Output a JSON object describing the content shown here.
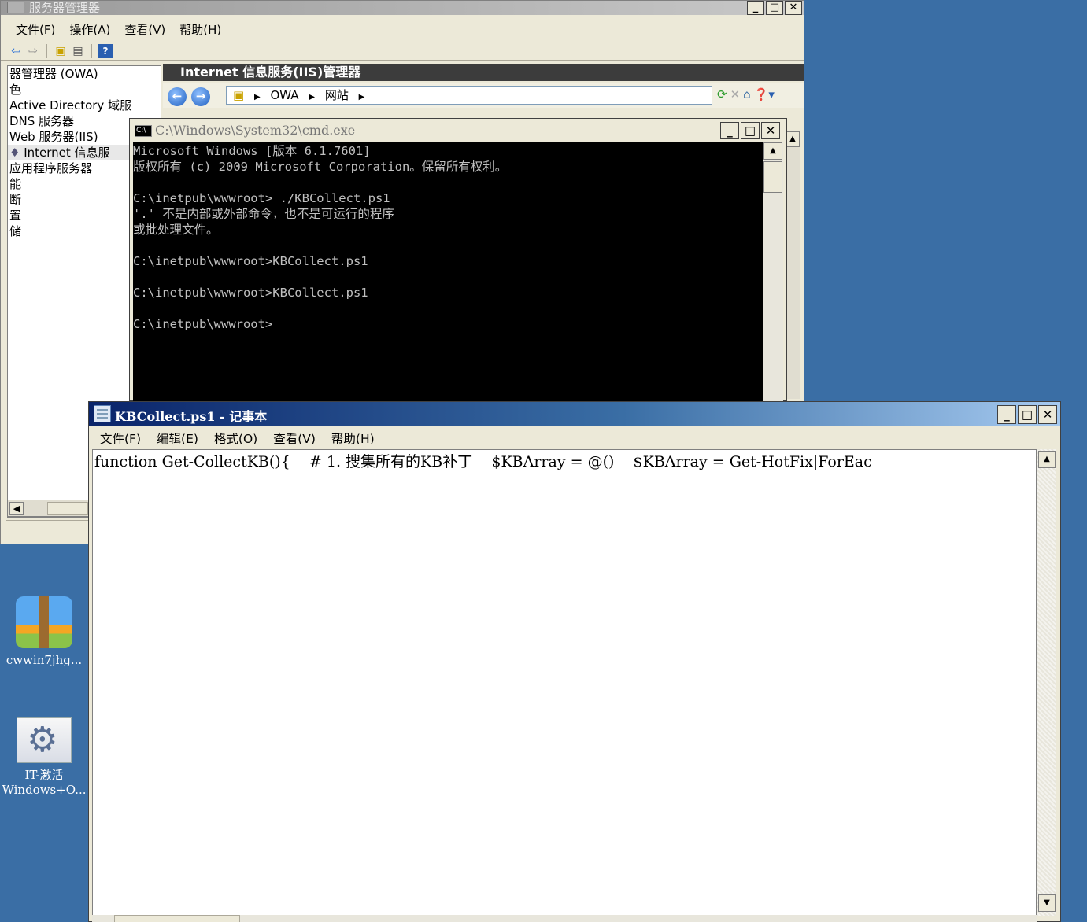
{
  "server_manager": {
    "title": "服务器管理器",
    "menu": [
      "文件(F)",
      "操作(A)",
      "查看(V)",
      "帮助(H)"
    ],
    "tree": [
      "器管理器 (OWA)",
      "色",
      "Active Directory 域服",
      "DNS 服务器",
      "Web 服务器(IIS)",
      "Internet 信息服",
      "应用程序服务器",
      "能",
      "断",
      "置",
      "储"
    ],
    "iis_header": "Internet 信息服务(IIS)管理器",
    "address": [
      "OWA",
      "网站"
    ]
  },
  "cmd": {
    "title": "C:\\Windows\\System32\\cmd.exe",
    "lines": [
      "Microsoft Windows [版本 6.1.7601]",
      "版权所有 (c) 2009 Microsoft Corporation。保留所有权利。",
      "",
      "C:\\inetpub\\wwwroot> ./KBCollect.ps1",
      "'.' 不是内部或外部命令，也不是可运行的程序",
      "或批处理文件。",
      "",
      "C:\\inetpub\\wwwroot>KBCollect.ps1",
      "",
      "C:\\inetpub\\wwwroot>KBCollect.ps1",
      "",
      "C:\\inetpub\\wwwroot>"
    ]
  },
  "notepad": {
    "title": "KBCollect.ps1 - 记事本",
    "menu": [
      "文件(F)",
      "编辑(E)",
      "格式(O)",
      "查看(V)",
      "帮助(H)"
    ],
    "content": "function Get-CollectKB(){    # 1. 搜集所有的KB补丁    $KBArray = @()    $KBArray = Get-HotFix|ForEac"
  },
  "desktop": {
    "icons": [
      {
        "label_line1": "cwwin7jhg...",
        "label_line2": ""
      },
      {
        "label_line1": "IT-激活",
        "label_line2": "Windows+O..."
      }
    ]
  }
}
